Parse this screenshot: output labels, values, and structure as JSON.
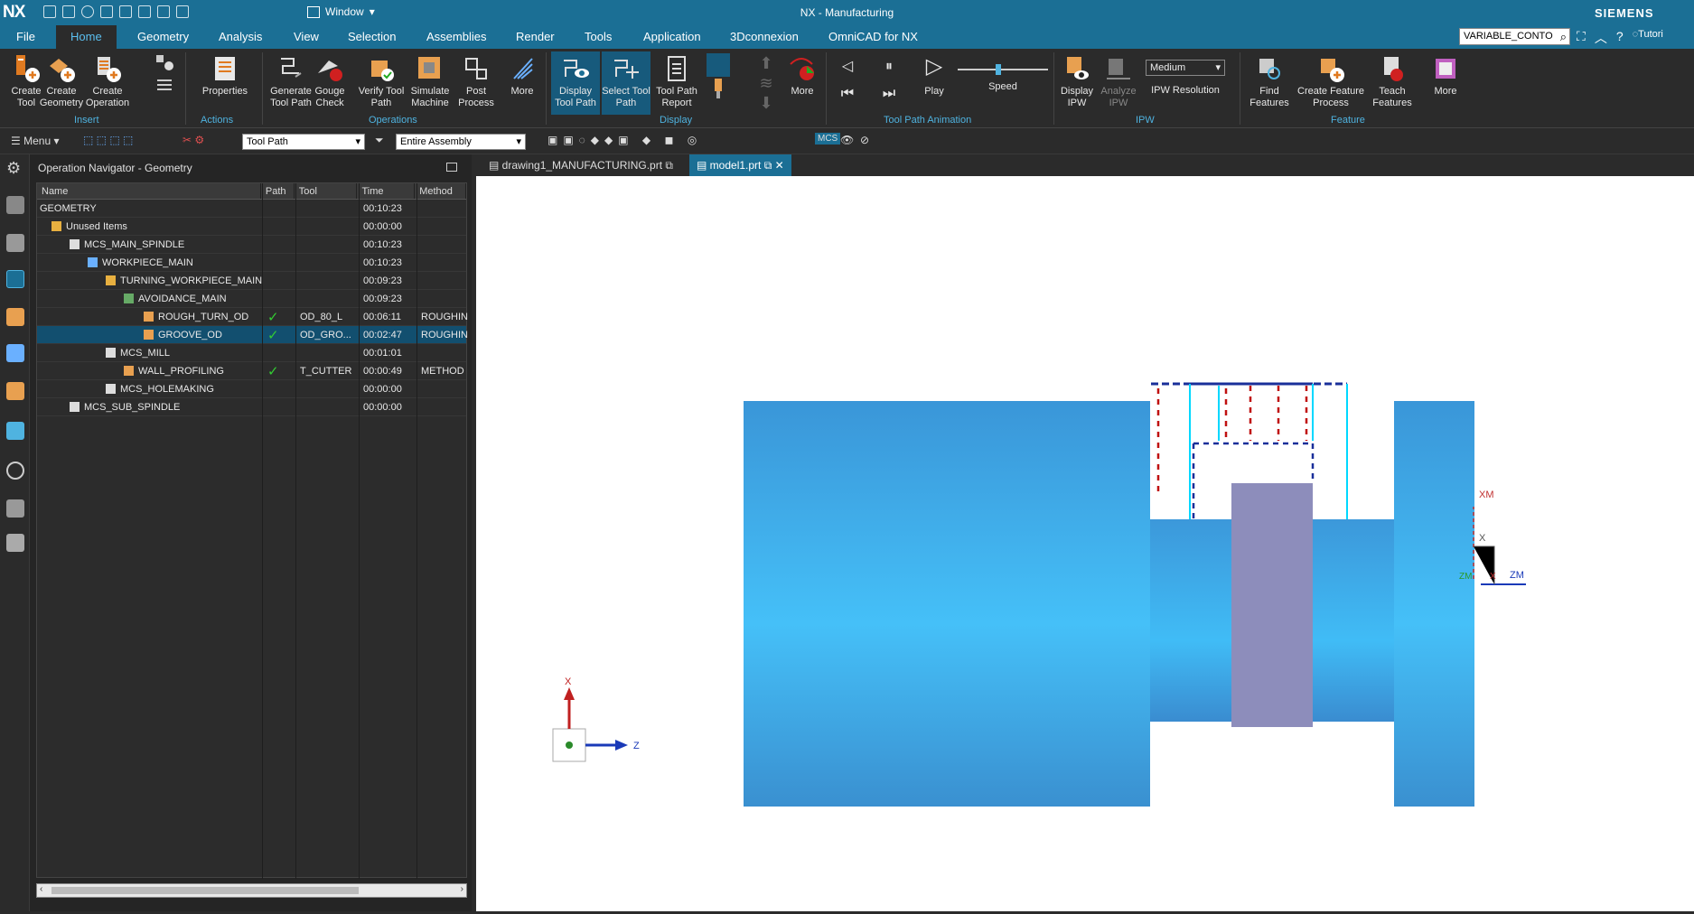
{
  "titlebar": {
    "logo": "NX",
    "window_menu": "Window",
    "title": "NX - Manufacturing",
    "brand": "SIEMENS",
    "tutorial": "Tutori"
  },
  "menubar": {
    "tabs": [
      "File",
      "Home",
      "Geometry",
      "Analysis",
      "View",
      "Selection",
      "Assemblies",
      "Render",
      "Tools",
      "Application",
      "3Dconnexion",
      "OmniCAD for NX"
    ],
    "active_tab": "Home",
    "search_value": "VARIABLE_CONTO"
  },
  "ribbon": {
    "buttons": [
      "Create Tool",
      "Create Geometry",
      "Create Operation",
      "Properties",
      "Generate Tool Path",
      "Gouge Check",
      "Verify Tool Path",
      "Simulate Machine",
      "Post Process",
      "More",
      "Display Tool Path",
      "Select Tool Path",
      "Tool Path Report",
      "More",
      "Play",
      "Speed",
      "Display IPW",
      "Analyze IPW",
      "Find Features",
      "Create Feature Process",
      "Teach Features",
      "More"
    ],
    "groups": [
      "Insert",
      "Actions",
      "Operations",
      "Display",
      "Tool Path Animation",
      "IPW",
      "Feature"
    ],
    "ipw_resolution_value": "Medium",
    "ipw_resolution_label": "IPW Resolution"
  },
  "cmdbar": {
    "menu": "Menu",
    "filter_value": "Tool Path",
    "scope_value": "Entire Assembly"
  },
  "navigator": {
    "title": "Operation Navigator - Geometry",
    "columns": [
      "Name",
      "Path",
      "Tool",
      "Time",
      "Method"
    ],
    "rows": [
      {
        "name": "GEOMETRY",
        "path": "",
        "tool": "",
        "time": "00:10:23",
        "method": ""
      },
      {
        "name": "Unused Items",
        "path": "",
        "tool": "",
        "time": "00:00:00",
        "method": ""
      },
      {
        "name": "MCS_MAIN_SPINDLE",
        "path": "",
        "tool": "",
        "time": "00:10:23",
        "method": ""
      },
      {
        "name": "WORKPIECE_MAIN",
        "path": "",
        "tool": "",
        "time": "00:10:23",
        "method": ""
      },
      {
        "name": "TURNING_WORKPIECE_MAIN",
        "path": "",
        "tool": "",
        "time": "00:09:23",
        "method": ""
      },
      {
        "name": "AVOIDANCE_MAIN",
        "path": "",
        "tool": "",
        "time": "00:09:23",
        "method": ""
      },
      {
        "name": "ROUGH_TURN_OD",
        "path": "✓",
        "tool": "OD_80_L",
        "time": "00:06:11",
        "method": "ROUGHIN"
      },
      {
        "name": "GROOVE_OD",
        "path": "✓",
        "tool": "OD_GRO...",
        "time": "00:02:47",
        "method": "ROUGHIN"
      },
      {
        "name": "MCS_MILL",
        "path": "",
        "tool": "",
        "time": "00:01:01",
        "method": ""
      },
      {
        "name": "WALL_PROFILING",
        "path": "✓",
        "tool": "T_CUTTER",
        "time": "00:00:49",
        "method": "METHOD"
      },
      {
        "name": "MCS_HOLEMAKING",
        "path": "",
        "tool": "",
        "time": "00:00:00",
        "method": ""
      },
      {
        "name": "MCS_SUB_SPINDLE",
        "path": "",
        "tool": "",
        "time": "00:00:00",
        "method": ""
      }
    ]
  },
  "file_tabs": [
    "drawing1_MANUFACTURING.prt",
    "model1.prt"
  ],
  "viewport": {
    "csys_labels": [
      "XM",
      "X",
      "ZM",
      "ZM",
      "X"
    ],
    "triad_x": "X",
    "triad_z": "Z"
  }
}
